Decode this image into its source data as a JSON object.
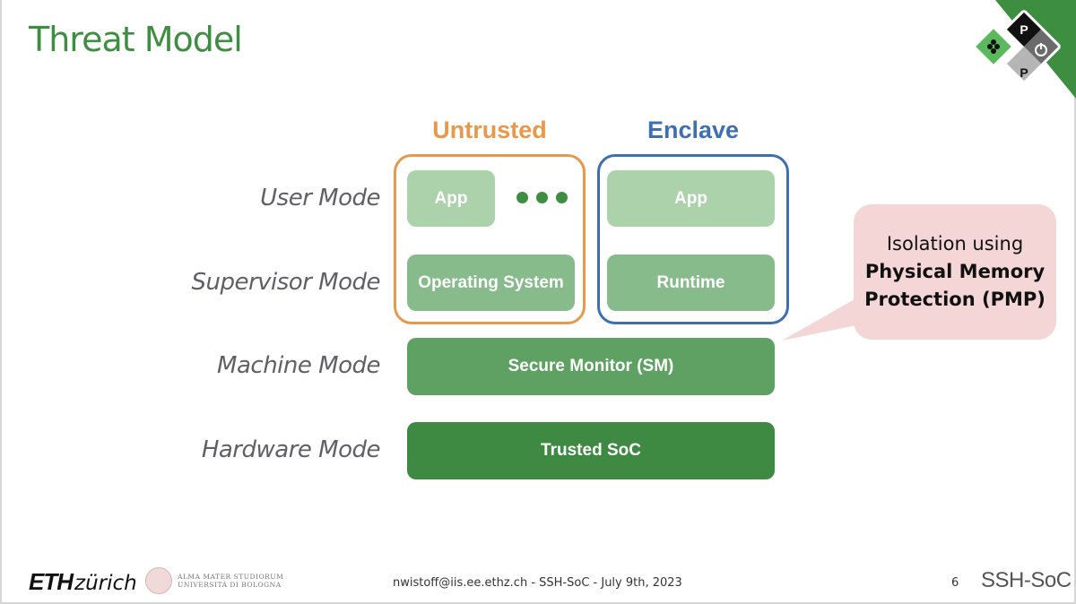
{
  "slide": {
    "title": "Threat Model",
    "page_number": "6"
  },
  "diagram": {
    "mode_labels": [
      "User Mode",
      "Supervisor Mode",
      "Machine Mode",
      "Hardware Mode"
    ],
    "groups": {
      "untrusted": {
        "title": "Untrusted",
        "color": "#e8984b"
      },
      "enclave": {
        "title": "Enclave",
        "color": "#3f6fb0"
      }
    },
    "blocks": {
      "untrusted_app": "App",
      "untrusted_os": "Operating System",
      "enclave_app": "App",
      "enclave_runtime": "Runtime",
      "secure_monitor": "Secure Monitor (SM)",
      "trusted_soc": "Trusted SoC"
    },
    "more_indicator": "ellipsis",
    "callout": {
      "line1": "Isolation using",
      "line2": "Physical Memory",
      "line3": "Protection (PMP)"
    }
  },
  "footer": {
    "eth_logo_bold": "ETH",
    "eth_logo_rest": "zürich",
    "unibo_line1": "ALMA MATER STUDIORUM",
    "unibo_line2": "UNIVERSITÀ DI BOLOGNA",
    "center_text": "nwistoff@iis.ee.ethz.ch - SSH-SoC - July 9th, 2023",
    "brand": "SSH-SoC"
  },
  "colors": {
    "title_green": "#3e8e41",
    "corner_green": "#3e8e41",
    "callout_bg": "#f3d6d5"
  }
}
